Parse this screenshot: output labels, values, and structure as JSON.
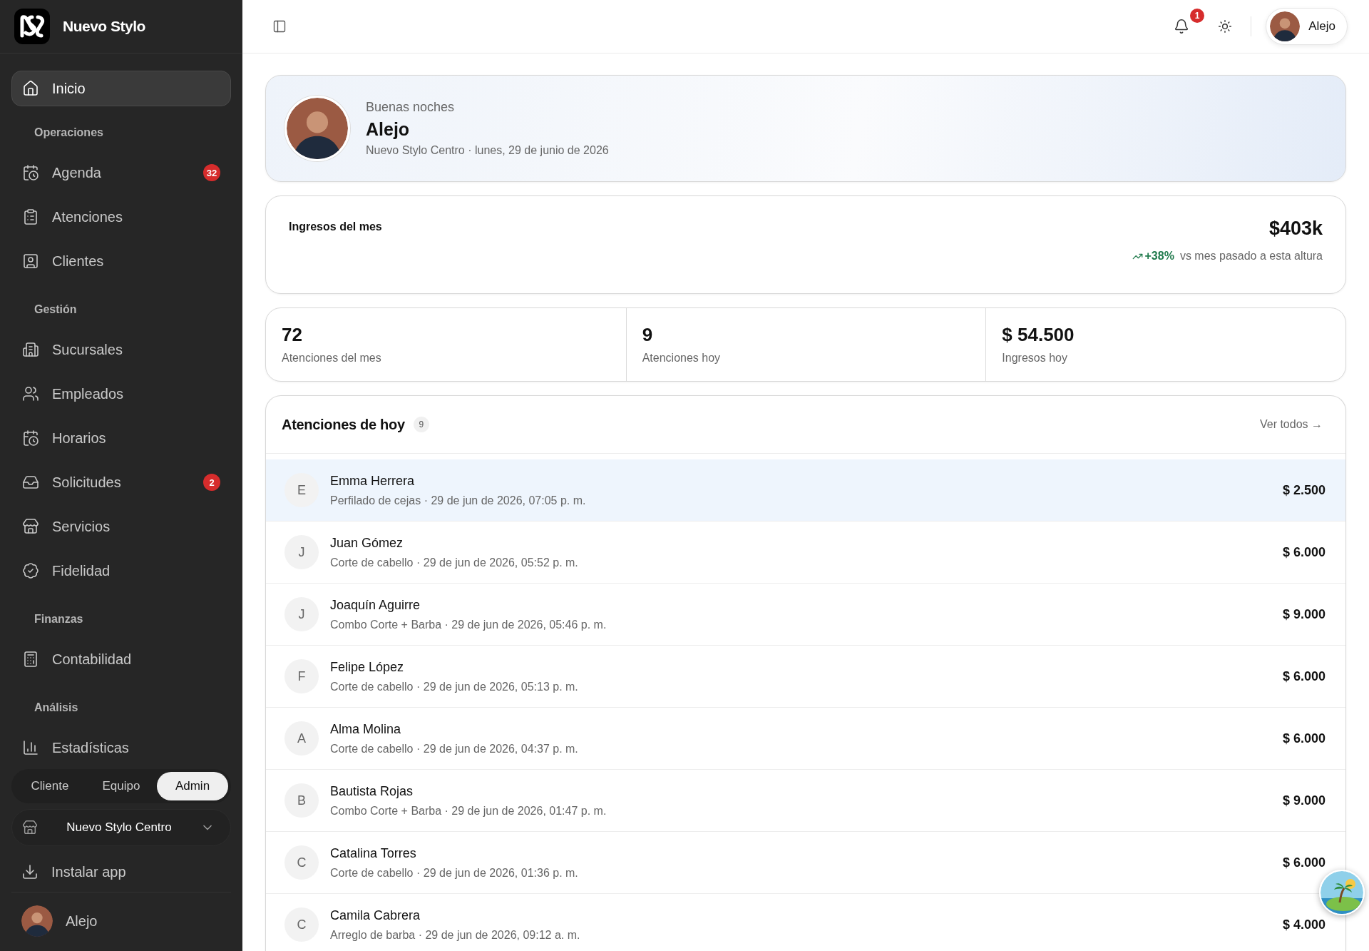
{
  "brand": {
    "name": "Nuevo Stylo"
  },
  "sidebar": {
    "sections": [
      {
        "items": [
          {
            "label": "Inicio",
            "selected": true
          }
        ]
      },
      {
        "title": "Operaciones",
        "items": [
          {
            "label": "Agenda",
            "badge": "32",
            "selected": false
          },
          {
            "label": "Atenciones",
            "selected": false
          },
          {
            "label": "Clientes",
            "selected": false
          }
        ]
      },
      {
        "title": "Gestión",
        "items": [
          {
            "label": "Sucursales",
            "selected": false
          },
          {
            "label": "Empleados",
            "selected": false
          },
          {
            "label": "Horarios",
            "selected": false
          },
          {
            "label": "Solicitudes",
            "badge": "2",
            "selected": false
          },
          {
            "label": "Servicios",
            "selected": false
          },
          {
            "label": "Fidelidad",
            "selected": false
          }
        ]
      },
      {
        "title": "Finanzas",
        "items": [
          {
            "label": "Contabilidad",
            "selected": false
          }
        ]
      },
      {
        "title": "Análisis",
        "items": [
          {
            "label": "Estadísticas",
            "selected": false
          }
        ]
      }
    ]
  },
  "role_switch": [
    {
      "label": "Cliente",
      "selected": false
    },
    {
      "label": "Equipo",
      "selected": false
    },
    {
      "label": "Admin",
      "selected": true
    }
  ],
  "branch_selector": {
    "value": "Nuevo Stylo Centro"
  },
  "install_button": "Instalar app",
  "sidebar_user": {
    "name": "Alejo"
  },
  "header": {
    "notifications_badge": "1",
    "user_name": "Alejo"
  },
  "welcome": {
    "greeting": "Buenas noches",
    "name": "Alejo",
    "branch": "Nuevo Stylo Centro",
    "separator": "·",
    "date": "lunes, 29 de junio de 2026"
  },
  "revenue": {
    "label": "Ingresos del mes",
    "value": "$403k",
    "change": "+38%",
    "comparison": "vs mes pasado a esta altura"
  },
  "stats": [
    {
      "value": "72",
      "label": "Atenciones del mes"
    },
    {
      "value": "9",
      "label": "Atenciones hoy"
    },
    {
      "value": "$ 54.500",
      "label": "Ingresos hoy"
    }
  ],
  "appointments": {
    "title": "Atenciones de hoy",
    "count": "9",
    "link": "Ver todos →",
    "rows": [
      {
        "initial": "E",
        "name": "Emma Herrera",
        "detail": "Perfilado de cejas · 29 de jun de 2026, 07:05 p. m.",
        "amount": "$ 2.500",
        "selected": true
      },
      {
        "initial": "J",
        "name": "Juan Gómez",
        "detail": "Corte de cabello · 29 de jun de 2026, 05:52 p. m.",
        "amount": "$ 6.000",
        "selected": false
      },
      {
        "initial": "J",
        "name": "Joaquín Aguirre",
        "detail": "Combo Corte + Barba · 29 de jun de 2026, 05:46 p. m.",
        "amount": "$ 9.000",
        "selected": false
      },
      {
        "initial": "F",
        "name": "Felipe López",
        "detail": "Corte de cabello · 29 de jun de 2026, 05:13 p. m.",
        "amount": "$ 6.000",
        "selected": false
      },
      {
        "initial": "A",
        "name": "Alma Molina",
        "detail": "Corte de cabello · 29 de jun de 2026, 04:37 p. m.",
        "amount": "$ 6.000",
        "selected": false
      },
      {
        "initial": "B",
        "name": "Bautista Rojas",
        "detail": "Combo Corte + Barba · 29 de jun de 2026, 01:47 p. m.",
        "amount": "$ 9.000",
        "selected": false
      },
      {
        "initial": "C",
        "name": "Catalina Torres",
        "detail": "Corte de cabello · 29 de jun de 2026, 01:36 p. m.",
        "amount": "$ 6.000",
        "selected": false
      },
      {
        "initial": "C",
        "name": "Camila Cabrera",
        "detail": "Arreglo de barba · 29 de jun de 2026, 09:12 a. m.",
        "amount": "$ 4.000",
        "selected": false
      }
    ]
  }
}
